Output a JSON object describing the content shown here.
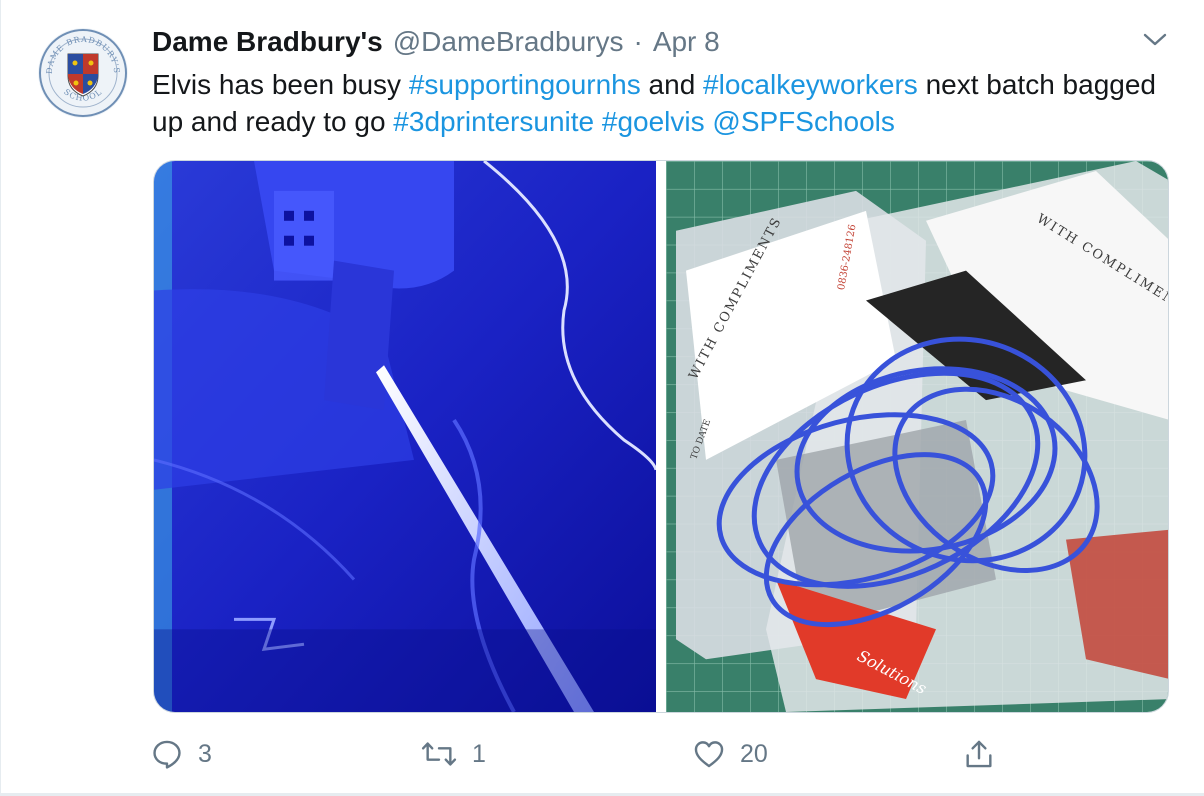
{
  "tweet": {
    "display_name": "Dame Bradbury's",
    "handle": "@DameBradburys",
    "separator": "·",
    "date": "Apr 8",
    "text_parts": [
      {
        "text": "Elvis has been busy ",
        "tag": false
      },
      {
        "text": "#supportingournhs",
        "tag": true
      },
      {
        "text": " and ",
        "tag": false
      },
      {
        "text": "#localkeyworkers",
        "tag": true
      },
      {
        "text": " next batch bagged up and ready to go ",
        "tag": false
      },
      {
        "text": "#3dprintersunite",
        "tag": true
      },
      {
        "text": " ",
        "tag": false
      },
      {
        "text": "#goelvis",
        "tag": true
      },
      {
        "text": " ",
        "tag": false
      },
      {
        "text": "@SPFSchools",
        "tag": true
      }
    ],
    "avatar": {
      "ring_text_top": "DAME BRADBURY'S",
      "ring_text_bottom": "SCHOOL"
    },
    "media": {
      "photo_left_desc_icon": "3d-printer-photo",
      "photo_right_desc_icon": "bagged-headbands-photo",
      "bag_label_1": "WITH COMPLIMENTS",
      "bag_label_2": "WITH COMPLIMENTS",
      "bag_date_1": "TO DATE",
      "bag_phone": "0836-248126",
      "red_label": "Solutions"
    },
    "actions": {
      "reply_count": "3",
      "retweet_count": "1",
      "like_count": "20"
    },
    "colors": {
      "link": "#1b95e0",
      "muted": "#657786",
      "text": "#14171a"
    }
  }
}
